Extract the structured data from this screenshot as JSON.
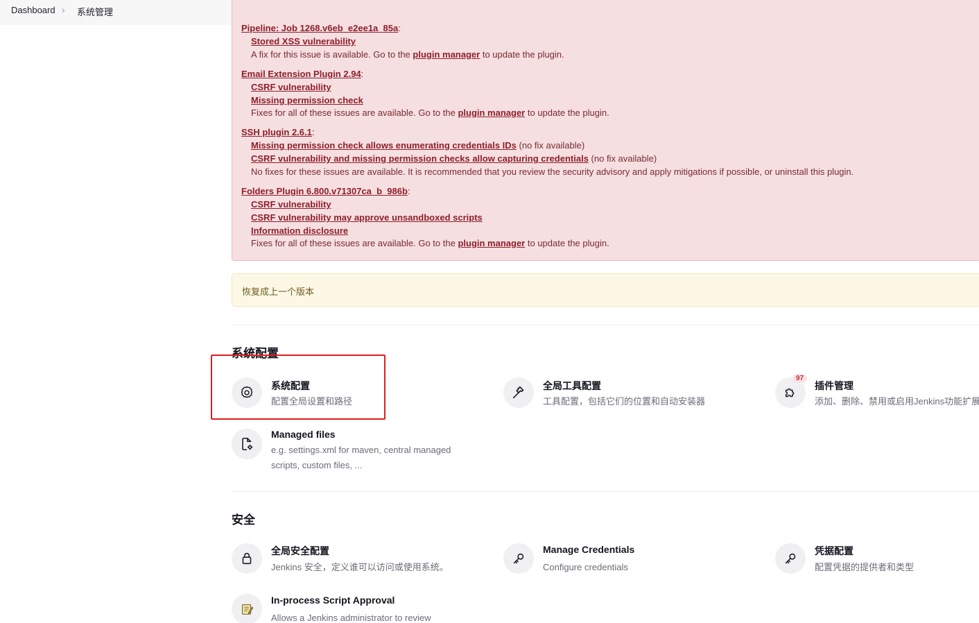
{
  "breadcrumb": {
    "home": "Dashboard",
    "current": "系统管理"
  },
  "warnings": {
    "pipeline_job": {
      "name": "Pipeline: Job 1268.v6eb_e2ee1a_85a",
      "issue1": "Stored XSS vulnerability",
      "fix_pre": "A fix for this issue is available. Go to the",
      "fix_link": "plugin manager",
      "fix_post": "to update the plugin."
    },
    "email_ext": {
      "name": "Email Extension Plugin 2.94",
      "issue1": "CSRF vulnerability",
      "issue2": "Missing permission check",
      "fix_pre": "Fixes for all of these issues are available. Go to the",
      "fix_link": "plugin manager",
      "fix_post": "to update the plugin."
    },
    "ssh": {
      "name": "SSH plugin 2.6.1",
      "issue1": "Missing permission check allows enumerating credentials IDs",
      "issue1_note": "(no fix available)",
      "issue2": "CSRF vulnerability and missing permission checks allow capturing credentials",
      "issue2_note": "(no fix available)",
      "note": "No fixes for these issues are available. It is recommended that you review the security advisory and apply mitigations if possible, or uninstall this plugin."
    },
    "folders": {
      "name": "Folders Plugin 6.800.v71307ca_b_986b",
      "issue1": "CSRF vulnerability",
      "issue2": "CSRF vulnerability may approve unsandboxed scripts",
      "issue3": "Information disclosure",
      "fix_pre": "Fixes for all of these issues are available. Go to the",
      "fix_link": "plugin manager",
      "fix_post": "to update the plugin."
    }
  },
  "downgrade": {
    "label": "恢复成上一个版本"
  },
  "sections": {
    "system_config": {
      "title": "系统配置",
      "configure": {
        "title": "系统配置",
        "desc": "配置全局设置和路径",
        "icon": "gear-icon"
      },
      "tools": {
        "title": "全局工具配置",
        "desc": "工具配置，包括它们的位置和自动安装器",
        "icon": "hammer-icon"
      },
      "plugins": {
        "title": "插件管理",
        "desc": "添加、删除、禁用或启用Jenkins功能扩展",
        "badge": "97",
        "icon": "puzzle-icon"
      },
      "managed_files": {
        "title": "Managed files",
        "desc1": "e.g. settings.xml for maven, central managed",
        "desc2": "scripts, custom files, ...",
        "icon": "file-gear-icon"
      }
    },
    "security": {
      "title": "安全",
      "global_security": {
        "title": "全局安全配置",
        "desc": "Jenkins 安全，定义谁可以访问或使用系统。",
        "icon": "lock-icon"
      },
      "credentials": {
        "title": "Manage Credentials",
        "desc": "Configure credentials",
        "icon": "key-icon"
      },
      "credential_providers": {
        "title": "凭据配置",
        "desc": "配置凭据的提供者和类型",
        "icon": "key-icon"
      },
      "script_approval": {
        "title": "In-process Script Approval",
        "desc": "Allows a Jenkins administrator to review",
        "icon": "notepad-icon"
      }
    }
  },
  "colors": {
    "danger_bg": "#f5dfe1",
    "danger_link": "#8f1f2a",
    "warning_bg": "#fdf8e6",
    "highlight": "#e31b1b"
  }
}
